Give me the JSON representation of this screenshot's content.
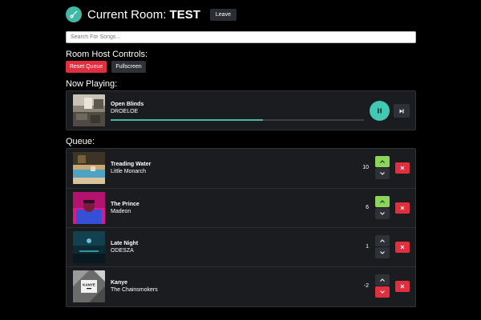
{
  "header": {
    "title_prefix": "Current Room: ",
    "room_name": "TEST",
    "leave_label": "Leave"
  },
  "search": {
    "placeholder": "Search For Songs..."
  },
  "host_controls": {
    "heading": "Room Host Controls:",
    "reset_label": "Reset Queue",
    "fullscreen_label": "Fullscreen"
  },
  "now_playing": {
    "heading": "Now Playing:",
    "title": "Open Blinds",
    "artist": "DROELOE",
    "progress": 0.6
  },
  "queue": {
    "heading": "Queue:",
    "items": [
      {
        "title": "Treading Water",
        "artist": "Little Monarch",
        "votes": "10",
        "vote_state": "up"
      },
      {
        "title": "The Prince",
        "artist": "Madeon",
        "votes": "6",
        "vote_state": "up"
      },
      {
        "title": "Late Night",
        "artist": "ODESZA",
        "votes": "1",
        "vote_state": "none"
      },
      {
        "title": "Kanye",
        "artist": "The Chainsmokers",
        "votes": "-2",
        "vote_state": "down"
      }
    ]
  },
  "art_text": {
    "kanye": "KANYE"
  },
  "colors": {
    "accent": "#42b8a6",
    "danger": "#e0303f",
    "upvote": "#8bd65a",
    "card": "#1a1c20"
  }
}
